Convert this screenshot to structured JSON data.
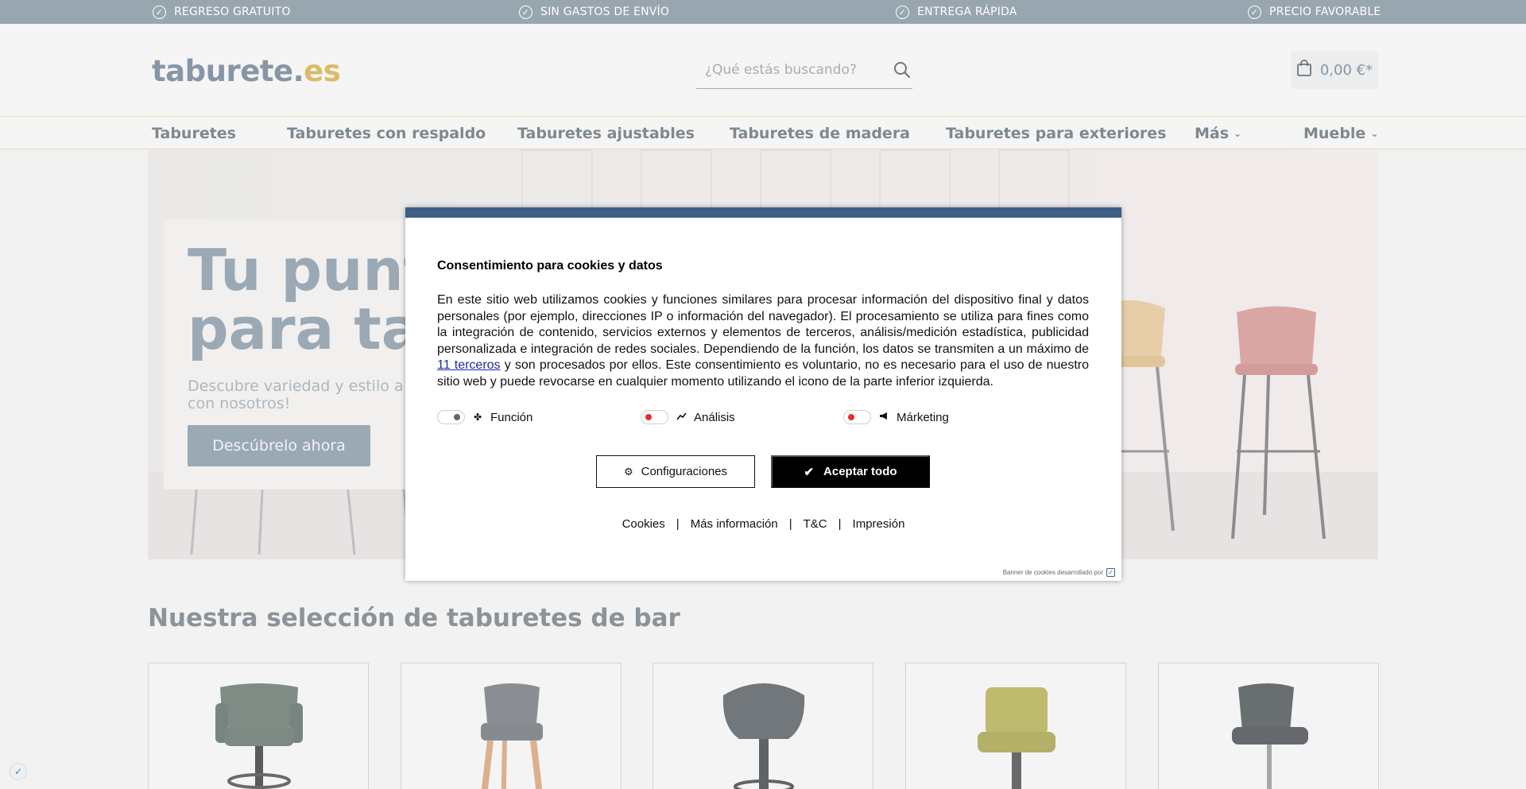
{
  "topbar": {
    "usps": [
      {
        "label": "REGRESO GRATUITO",
        "icon": "check-circle-icon"
      },
      {
        "label": "SIN GASTOS DE ENVÍO",
        "icon": "check-circle-icon"
      },
      {
        "label": "ENTREGA RÁPIDA",
        "icon": "check-circle-icon"
      },
      {
        "label": "PRECIO FAVORABLE",
        "icon": "check-circle-icon"
      }
    ]
  },
  "header": {
    "logo_main": "taburete.",
    "logo_tld": "es",
    "search_placeholder": "¿Qué estás buscando?",
    "cart_total": "0,00 €*"
  },
  "nav": {
    "items": [
      {
        "label": "Taburetes"
      },
      {
        "label": "Taburetes con respaldo"
      },
      {
        "label": "Taburetes ajustables"
      },
      {
        "label": "Taburetes de madera"
      },
      {
        "label": "Taburetes para exteriores"
      },
      {
        "label": "Más",
        "dropdown": true
      },
      {
        "label": "Mueble",
        "dropdown": true
      }
    ]
  },
  "hero": {
    "title_line1": "Tu punto",
    "title_line2": "para tabu",
    "subtitle_line1": "Descubre variedad y estilo a los m",
    "subtitle_line2": "con nosotros!",
    "cta": "Descúbrelo ahora"
  },
  "section": {
    "title": "Nuestra selección de taburetes de bar"
  },
  "products": [
    {
      "color": "#6e7d76"
    },
    {
      "color": "#7a7f84"
    },
    {
      "color": "#5f6569"
    },
    {
      "color": "#b6b15a"
    },
    {
      "color": "#555a5e"
    }
  ],
  "cookie": {
    "title": "Consentimiento para cookies y datos",
    "text_before_link": "En este sitio web utilizamos cookies y funciones similares para procesar información del dispositivo final y datos personales (por ejemplo, direcciones IP o información del navegador). El procesamiento se utiliza para fines como la integración de contenido, servicios externos y elementos de terceros, análisis/medición estadística, publicidad personalizada e integración de redes sociales. Dependiendo de la función, los datos se transmiten a un máximo de ",
    "link_text": "11 terceros",
    "text_after_link": " y son procesados por ellos. Este consentimiento es voluntario, no es necesario para el uso de nuestro sitio web y puede revocarse en cualquier momento utilizando el icono de la parte inferior izquierda.",
    "toggles": [
      {
        "label": "Función",
        "state": "on",
        "icon": "puzzle-icon"
      },
      {
        "label": "Análisis",
        "state": "off",
        "icon": "chart-line-icon"
      },
      {
        "label": "Márketing",
        "state": "off",
        "icon": "megaphone-icon"
      }
    ],
    "config_button": "Configuraciones",
    "accept_button": "Aceptar todo",
    "footer_links": [
      "Cookies",
      "Más información",
      "T&C",
      "Impresión"
    ],
    "separator": "|",
    "credit": "Banner de cookies desarrollado por"
  },
  "colors": {
    "topbar": "#8a9aa6",
    "brand_gold": "#d8b252",
    "modal_bar": "#3d5f86"
  }
}
